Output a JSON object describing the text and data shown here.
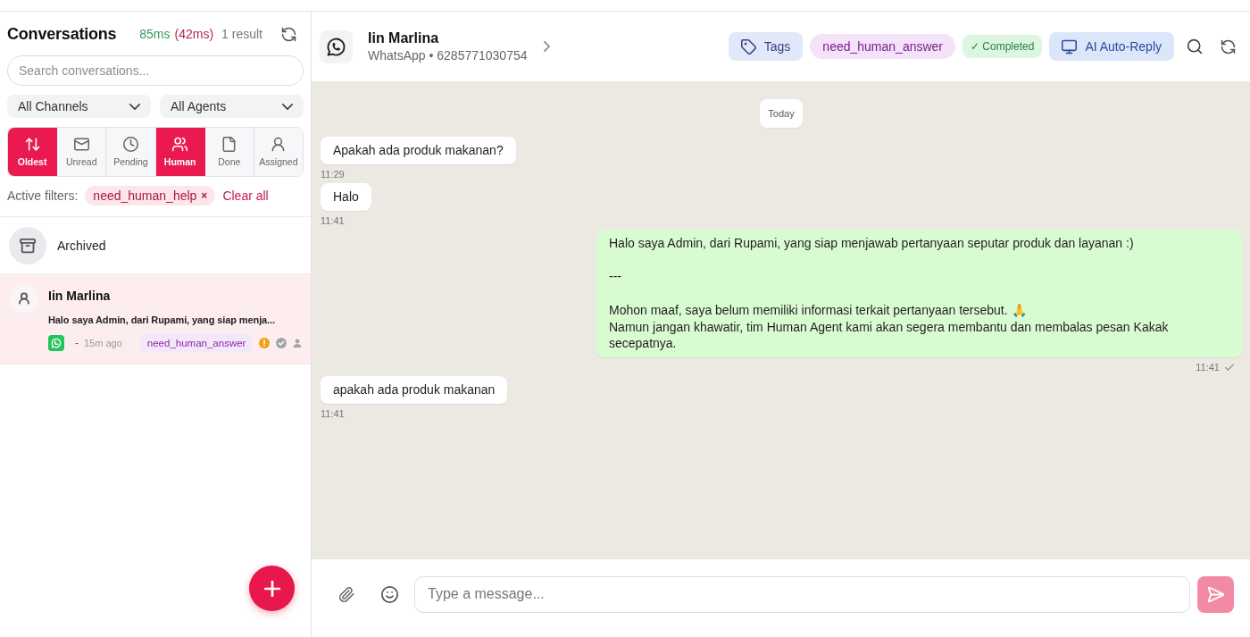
{
  "sidebar": {
    "title": "Conversations",
    "timing": "85ms",
    "timing_secondary": "(42ms)",
    "result_count": "1 result",
    "search": {
      "placeholder": "Search conversations..."
    },
    "dropdowns": [
      {
        "label": "All Channels"
      },
      {
        "label": "All Agents"
      }
    ],
    "filters": [
      {
        "kind": "sort",
        "label": "Oldest",
        "selected": true
      },
      {
        "kind": "unread",
        "label": "Unread",
        "selected": false
      },
      {
        "kind": "pending",
        "label": "Pending",
        "selected": false
      },
      {
        "kind": "human",
        "label": "Human",
        "selected": true
      },
      {
        "kind": "done",
        "label": "Done",
        "selected": false
      },
      {
        "kind": "assigned",
        "label": "Assigned",
        "selected": false
      }
    ],
    "active_filters": {
      "label": "Active filters:",
      "chips": [
        {
          "label": "need_human_help",
          "remove": "×"
        }
      ],
      "clear": "Clear all"
    },
    "archived": {
      "label": "Archived"
    },
    "conversations": [
      {
        "name": "Iin Marlina",
        "preview": "Halo saya Admin, dari Rupami, yang siap menja...",
        "separator": "-",
        "time": "15m ago",
        "tag": "need_human_answer",
        "selected": true
      }
    ]
  },
  "chat": {
    "header": {
      "name": "Iin Marlina",
      "subtitle": "WhatsApp • 6285771030754",
      "tags_button": "Tags",
      "tag": "need_human_answer",
      "status": "✓ Completed",
      "ai_button": "AI Auto-Reply"
    },
    "date_divider": "Today",
    "messages": [
      {
        "kind": "incoming",
        "text": "Apakah ada produk makanan?",
        "time": "11:29"
      },
      {
        "kind": "incoming",
        "text": "Halo",
        "time": "11:41"
      },
      {
        "kind": "outgoing",
        "text": "Halo saya Admin, dari Rupami, yang siap menjawab pertanyaan seputar produk dan layanan :)\n\n---\n\nMohon maaf, saya belum memiliki informasi terkait pertanyaan tersebut. 🙏\nNamun jangan khawatir, tim Human Agent kami akan segera membantu dan membalas pesan Kakak secepatnya.",
        "time": "11:41"
      },
      {
        "kind": "incoming",
        "text": "apakah ada produk makanan",
        "time": "11:41"
      }
    ],
    "composer": {
      "placeholder": "Type a message..."
    }
  }
}
